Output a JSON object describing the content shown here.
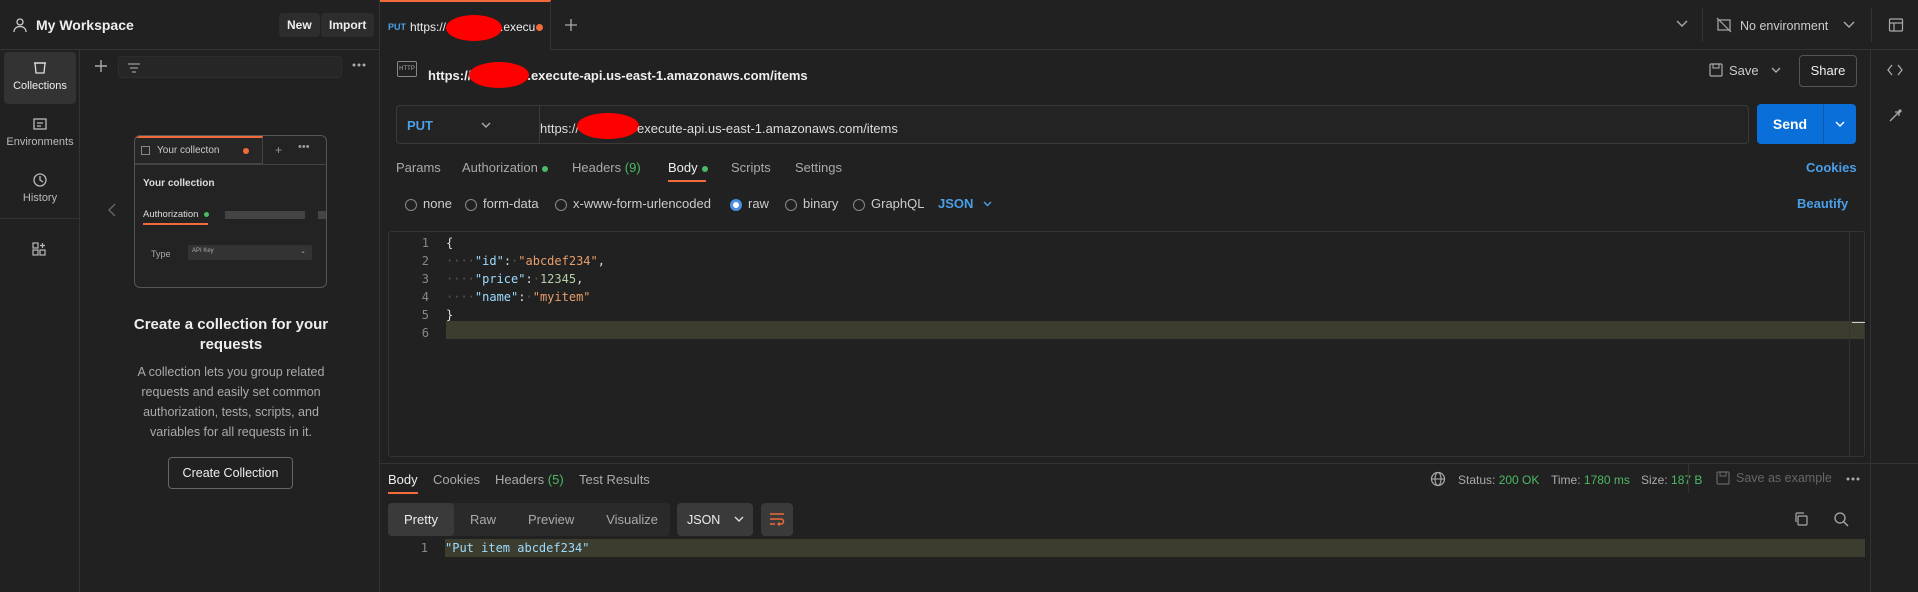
{
  "workspace": {
    "title": "My Workspace",
    "new_label": "New",
    "import_label": "Import"
  },
  "rail": {
    "items": [
      {
        "label": "Collections",
        "icon": "collections-icon"
      },
      {
        "label": "Environments",
        "icon": "environments-icon"
      },
      {
        "label": "History",
        "icon": "history-icon"
      },
      {
        "label": "",
        "icon": "apps-icon"
      }
    ]
  },
  "collections": {
    "preview": {
      "tab_label": "Your collecton",
      "heading": "Your collection",
      "auth_label": "Authorization",
      "type_label": "Type",
      "type_value": "API Key"
    },
    "empty_title": "Create a collection for your requests",
    "empty_desc": "A collection lets you group related requests and easily set common authorization, tests, scripts, and variables for all requests in it.",
    "create_button": "Create Collection"
  },
  "tab": {
    "method": "PUT",
    "title_start": "https://",
    "title_end": ".execu"
  },
  "environment": {
    "label": "No environment"
  },
  "request": {
    "url_prefix": "https://",
    "url_title_suffix": ".execute-api.us-east-1.amazonaws.com/items",
    "url_input_suffix": "execute-api.us-east-1.amazonaws.com/items",
    "method": "PUT",
    "save_label": "Save",
    "share_label": "Share",
    "send_label": "Send",
    "subtabs": {
      "params": "Params",
      "authorization": "Authorization",
      "headers": "Headers",
      "headers_count": "(9)",
      "body": "Body",
      "scripts": "Scripts",
      "settings": "Settings"
    },
    "cookies_label": "Cookies",
    "body_modes": {
      "none": "none",
      "form_data": "form-data",
      "urlencoded": "x-www-form-urlencoded",
      "raw": "raw",
      "binary": "binary",
      "graphql": "GraphQL",
      "json": "JSON"
    },
    "beautify_label": "Beautify",
    "code_lines": [
      "1",
      "2",
      "3",
      "4",
      "5",
      "6"
    ],
    "code": {
      "open_brace": "{",
      "id_key": "\"id\"",
      "id_val": "\"abcdef234\"",
      "price_key": "\"price\"",
      "price_val": "12345",
      "name_key": "\"name\"",
      "name_val": "\"myitem\"",
      "close_brace": "}"
    }
  },
  "response": {
    "tabs": {
      "body": "Body",
      "cookies": "Cookies",
      "headers": "Headers",
      "headers_count": "(5)",
      "test_results": "Test Results"
    },
    "status_label": "Status:",
    "status_value": "200 OK",
    "time_label": "Time:",
    "time_value": "1780 ms",
    "size_label": "Size:",
    "size_value": "187 B",
    "save_example": "Save as example",
    "views": {
      "pretty": "Pretty",
      "raw": "Raw",
      "preview": "Preview",
      "visualize": "Visualize"
    },
    "format": "JSON",
    "line_no": "1",
    "body_text": "\"Put item abcdef234\""
  },
  "colors": {
    "accent_orange": "#f26b3a",
    "send_blue": "#0a6fd8",
    "status_green": "#4cb963",
    "redaction_red": "#ff0000"
  }
}
